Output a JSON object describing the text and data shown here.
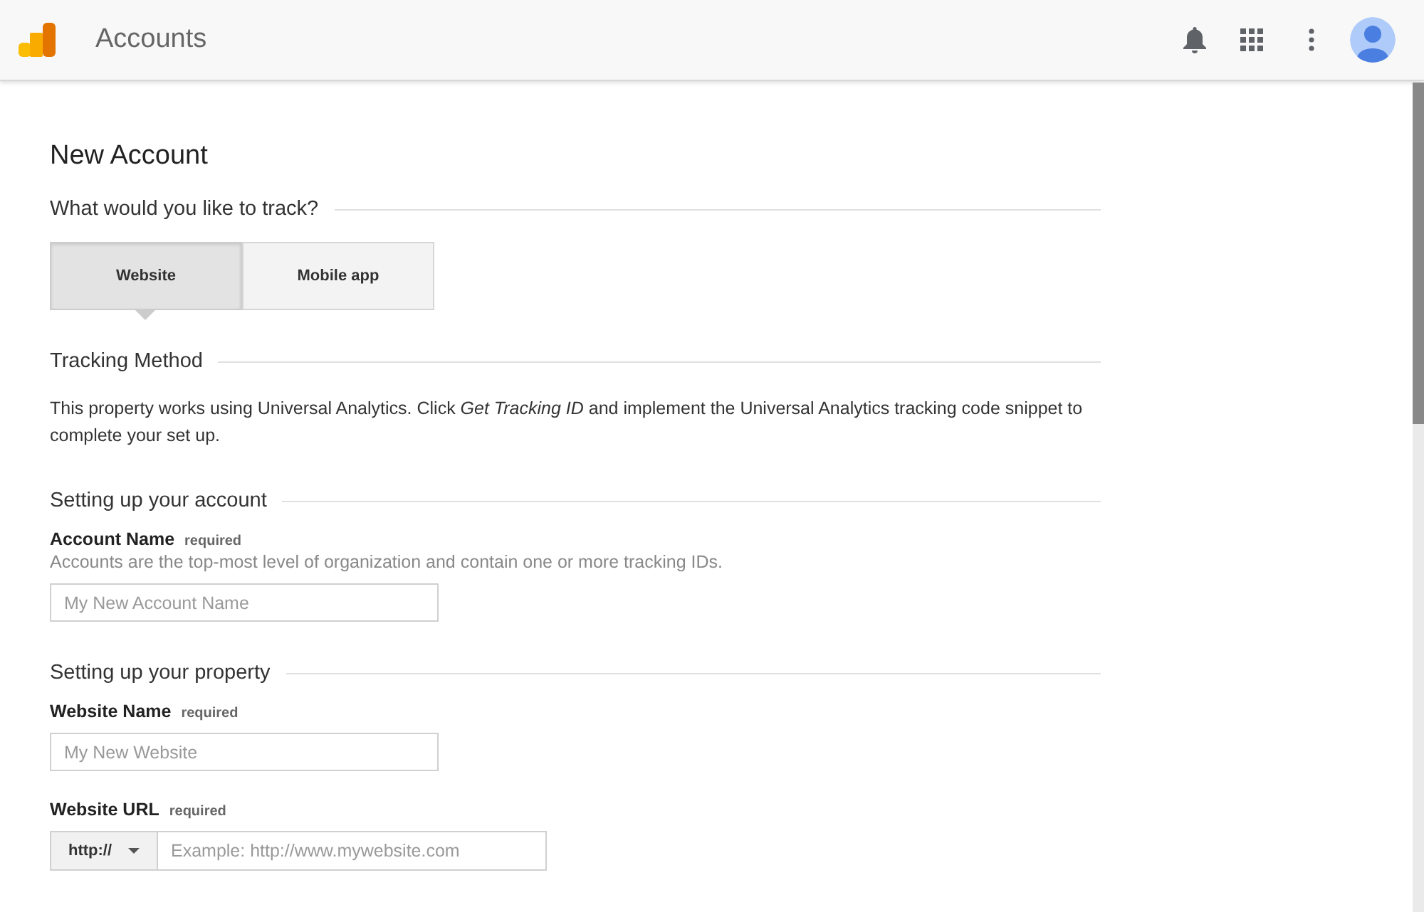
{
  "app_bar": {
    "title": "Accounts"
  },
  "page_title": "New Account",
  "track_section": {
    "heading": "What would you like to track?",
    "options": [
      {
        "label": "Website",
        "selected": true
      },
      {
        "label": "Mobile app",
        "selected": false
      }
    ]
  },
  "tracking_method": {
    "heading": "Tracking Method",
    "description": "This property works using Universal Analytics. Click *Get Tracking ID* and implement the Universal Analytics tracking code snippet to complete your set up."
  },
  "account_section": {
    "heading": "Setting up your account",
    "fields": [
      {
        "kind": "text",
        "label": "Account Name",
        "tag": "required",
        "help": "Accounts are the top-most level of organization and contain one or more tracking IDs.",
        "placeholder": "My New Account Name"
      }
    ]
  },
  "property_section": {
    "heading": "Setting up your property",
    "fields": [
      {
        "kind": "text",
        "label": "Website Name",
        "tag": "required",
        "placeholder": "My New Website"
      },
      {
        "kind": "url",
        "label": "Website URL",
        "tag": "required",
        "protocol": "http://",
        "placeholder": "Example: http://www.mywebsite.com"
      }
    ]
  }
}
